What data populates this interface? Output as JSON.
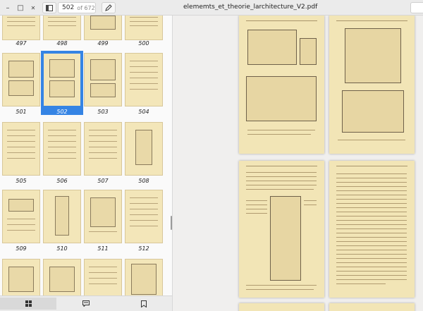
{
  "header": {
    "page_number": "502",
    "page_total": "of 672",
    "title": "elememts_et_theorie_larchitecture_V2.pdf",
    "icons": [
      "minimize-icon",
      "maximize-icon",
      "close-icon",
      "sidebar-toggle-icon",
      "pen-icon"
    ]
  },
  "sidebar": {
    "thumbnails": [
      "497",
      "498",
      "499",
      "500",
      "501",
      "502",
      "503",
      "504",
      "505",
      "506",
      "507",
      "508",
      "509",
      "510",
      "511",
      "512"
    ],
    "selected": "502"
  },
  "bottom_bar": {
    "tabs": [
      "thumbnails-icon",
      "annotations-icon",
      "bookmarks-icon"
    ],
    "active": 0
  },
  "colors": {
    "accent": "#3584e4",
    "paper": "#f2e5b6"
  }
}
